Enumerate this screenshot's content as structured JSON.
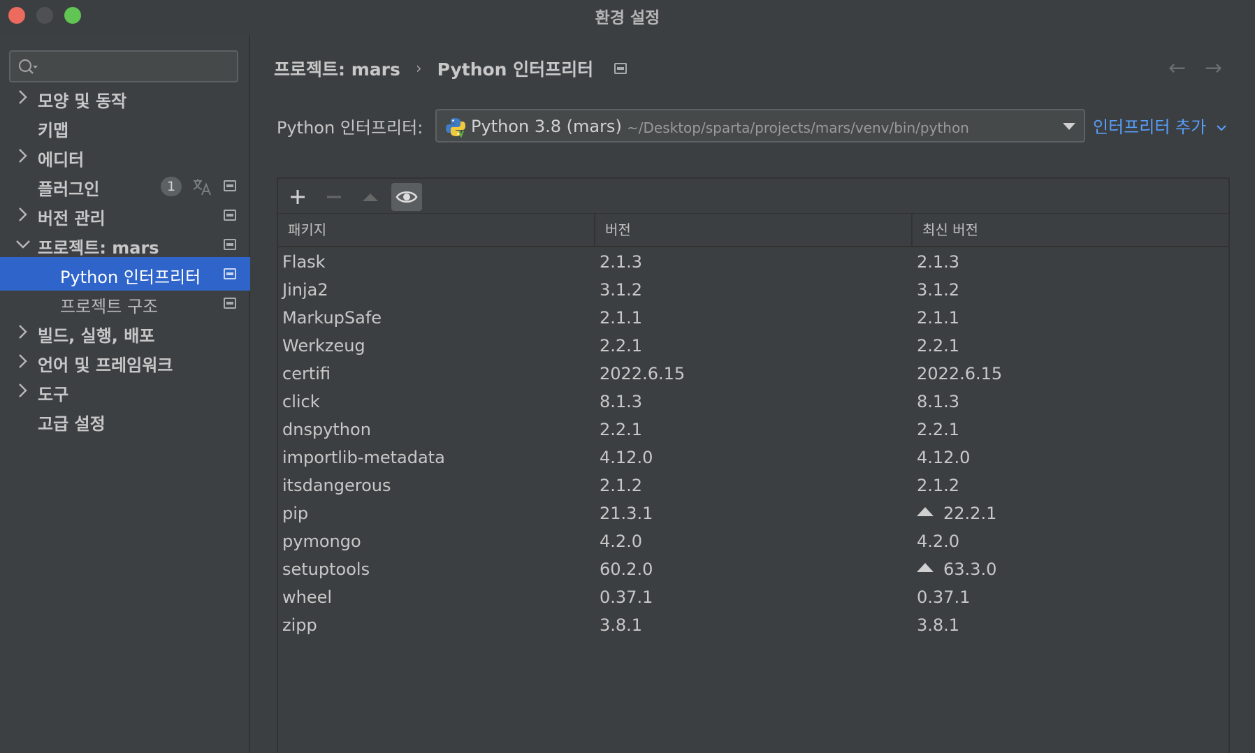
{
  "window": {
    "title": "환경 설정"
  },
  "sidebar": {
    "search": {
      "value": "",
      "placeholder": ""
    },
    "items": [
      {
        "label": "모양 및 동작",
        "expandable": true,
        "expanded": false
      },
      {
        "label": "키맵",
        "expandable": false
      },
      {
        "label": "에디터",
        "expandable": true,
        "expanded": false
      },
      {
        "label": "플러그인",
        "expandable": false,
        "badge": "1"
      },
      {
        "label": "버전 관리",
        "expandable": true,
        "expanded": false
      },
      {
        "label": "프로젝트: mars",
        "expandable": true,
        "expanded": true
      },
      {
        "label": "Python 인터프리터",
        "child": true,
        "selected": true
      },
      {
        "label": "프로젝트 구조",
        "child": true
      },
      {
        "label": "빌드, 실행, 배포",
        "expandable": true,
        "expanded": false
      },
      {
        "label": "언어 및 프레임워크",
        "expandable": true,
        "expanded": false
      },
      {
        "label": "도구",
        "expandable": true,
        "expanded": false
      },
      {
        "label": "고급 설정",
        "expandable": false
      }
    ]
  },
  "header": {
    "breadcrumb": [
      "프로젝트: mars",
      "Python 인터프리터"
    ],
    "separator": "›",
    "back": "←",
    "forward": "→"
  },
  "interpreter": {
    "label": "Python 인터프리터:",
    "name": "Python 3.8 (mars)",
    "path": "~/Desktop/sparta/projects/mars/venv/bin/python",
    "add_label": "인터프리터 추가"
  },
  "table": {
    "columns": [
      "패키지",
      "버전",
      "최신 버전"
    ],
    "rows": [
      {
        "package": "Flask",
        "version": "2.1.3",
        "latest": "2.1.3",
        "upgrade": false
      },
      {
        "package": "Jinja2",
        "version": "3.1.2",
        "latest": "3.1.2",
        "upgrade": false
      },
      {
        "package": "MarkupSafe",
        "version": "2.1.1",
        "latest": "2.1.1",
        "upgrade": false
      },
      {
        "package": "Werkzeug",
        "version": "2.2.1",
        "latest": "2.2.1",
        "upgrade": false
      },
      {
        "package": "certifi",
        "version": "2022.6.15",
        "latest": "2022.6.15",
        "upgrade": false
      },
      {
        "package": "click",
        "version": "8.1.3",
        "latest": "8.1.3",
        "upgrade": false
      },
      {
        "package": "dnspython",
        "version": "2.2.1",
        "latest": "2.2.1",
        "upgrade": false
      },
      {
        "package": "importlib-metadata",
        "version": "4.12.0",
        "latest": "4.12.0",
        "upgrade": false
      },
      {
        "package": "itsdangerous",
        "version": "2.1.2",
        "latest": "2.1.2",
        "upgrade": false
      },
      {
        "package": "pip",
        "version": "21.3.1",
        "latest": "22.2.1",
        "upgrade": true
      },
      {
        "package": "pymongo",
        "version": "4.2.0",
        "latest": "4.2.0",
        "upgrade": false
      },
      {
        "package": "setuptools",
        "version": "60.2.0",
        "latest": "63.3.0",
        "upgrade": true
      },
      {
        "package": "wheel",
        "version": "0.37.1",
        "latest": "0.37.1",
        "upgrade": false
      },
      {
        "package": "zipp",
        "version": "3.8.1",
        "latest": "3.8.1",
        "upgrade": false
      }
    ]
  },
  "colors": {
    "accent": "#2f65ca",
    "link": "#589df6",
    "background": "#3c3f41"
  }
}
